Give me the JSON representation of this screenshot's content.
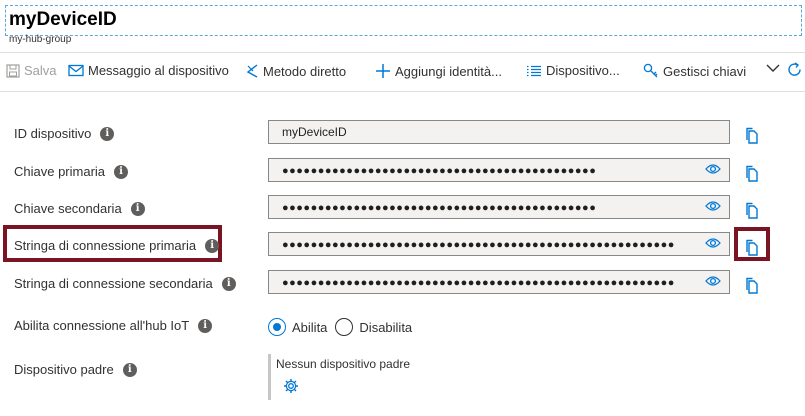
{
  "header": {
    "title": "myDeviceID",
    "subtitle": "my-hub-group"
  },
  "toolbar": {
    "save": "Salva",
    "message": "Messaggio al dispositivo",
    "direct_method": "Metodo diretto",
    "add_identity": "Aggiungi identità...",
    "device": "Dispositivo...",
    "manage_keys": "Gestisci chiavi"
  },
  "fields": {
    "device_id": {
      "label": "ID dispositivo",
      "value": "myDeviceID"
    },
    "primary_key": {
      "label": "Chiave primaria",
      "value": "●●●●●●●●●●●●●●●●●●●●●●●●●●●●●●●●●●●●●●●●●●●●"
    },
    "secondary_key": {
      "label": "Chiave secondaria",
      "value": "●●●●●●●●●●●●●●●●●●●●●●●●●●●●●●●●●●●●●●●●●●●●"
    },
    "primary_conn": {
      "label": "Stringa di connessione primaria",
      "value": "●●●●●●●●●●●●●●●●●●●●●●●●●●●●●●●●●●●●●●●●●●●●●●●●●●●●●●●"
    },
    "secondary_conn": {
      "label": "Stringa di connessione secondaria",
      "value": "●●●●●●●●●●●●●●●●●●●●●●●●●●●●●●●●●●●●●●●●●●●●●●●●●●●●●●●"
    }
  },
  "hub_connection": {
    "label": "Abilita connessione all'hub IoT",
    "enable": "Abilita",
    "disable": "Disabilita",
    "selected": "Abilita"
  },
  "parent": {
    "label": "Dispositivo padre",
    "value": "Nessun dispositivo padre"
  },
  "info_glyph": "i",
  "colors": {
    "accent": "#0078d4",
    "highlight": "#7a1422"
  }
}
